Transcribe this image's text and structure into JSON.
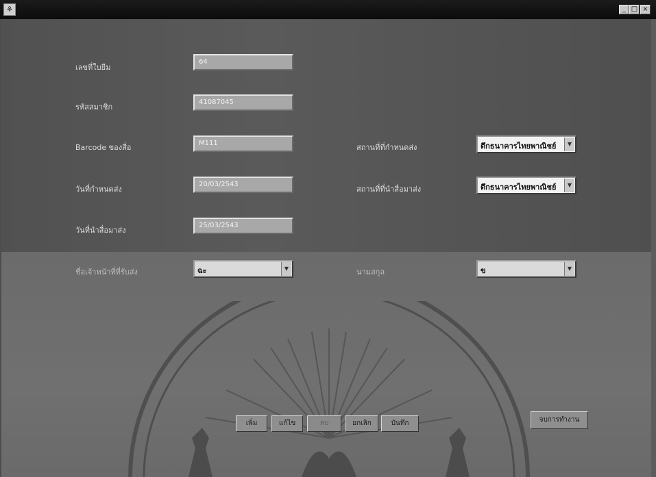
{
  "window": {
    "icon": "app-icon",
    "controls": [
      "minimize-icon",
      "maximize-icon",
      "close-icon"
    ]
  },
  "form": {
    "loan_number": {
      "label": "เลขที่ใบยืม",
      "value": "64"
    },
    "member_code": {
      "label": "รหัสสมาชิก",
      "value": "41087045"
    },
    "book_barcode": {
      "label": "Barcode ของสื่อ",
      "value": "M111"
    },
    "due_date": {
      "label": "วันที่กำหนดส่ง",
      "value": "20/03/2543"
    },
    "return_date": {
      "label": "วันที่นำสื่อมาส่ง",
      "value": "25/03/2543"
    },
    "due_location": {
      "label": "สถานที่ที่กำหนดส่ง",
      "value": "ตึกธนาคารไทยพาณิชย์"
    },
    "return_location": {
      "label": "สถานที่ที่นำสื่อมาส่ง",
      "value": "ตึกธนาคารไทยพาณิชย์"
    },
    "staff_name": {
      "label": "ชื่อเจ้าหน้าที่ที่รับส่ง",
      "value": "ฉะ"
    },
    "surname": {
      "label": "นามสกุล",
      "value": "ข"
    }
  },
  "buttons": {
    "add": "เพิ่ม",
    "edit": "แก้ไข",
    "delete": "ลบ",
    "cancel": "ยกเลิก",
    "save": "บันทึก",
    "exit": "จบการทำงาน"
  }
}
